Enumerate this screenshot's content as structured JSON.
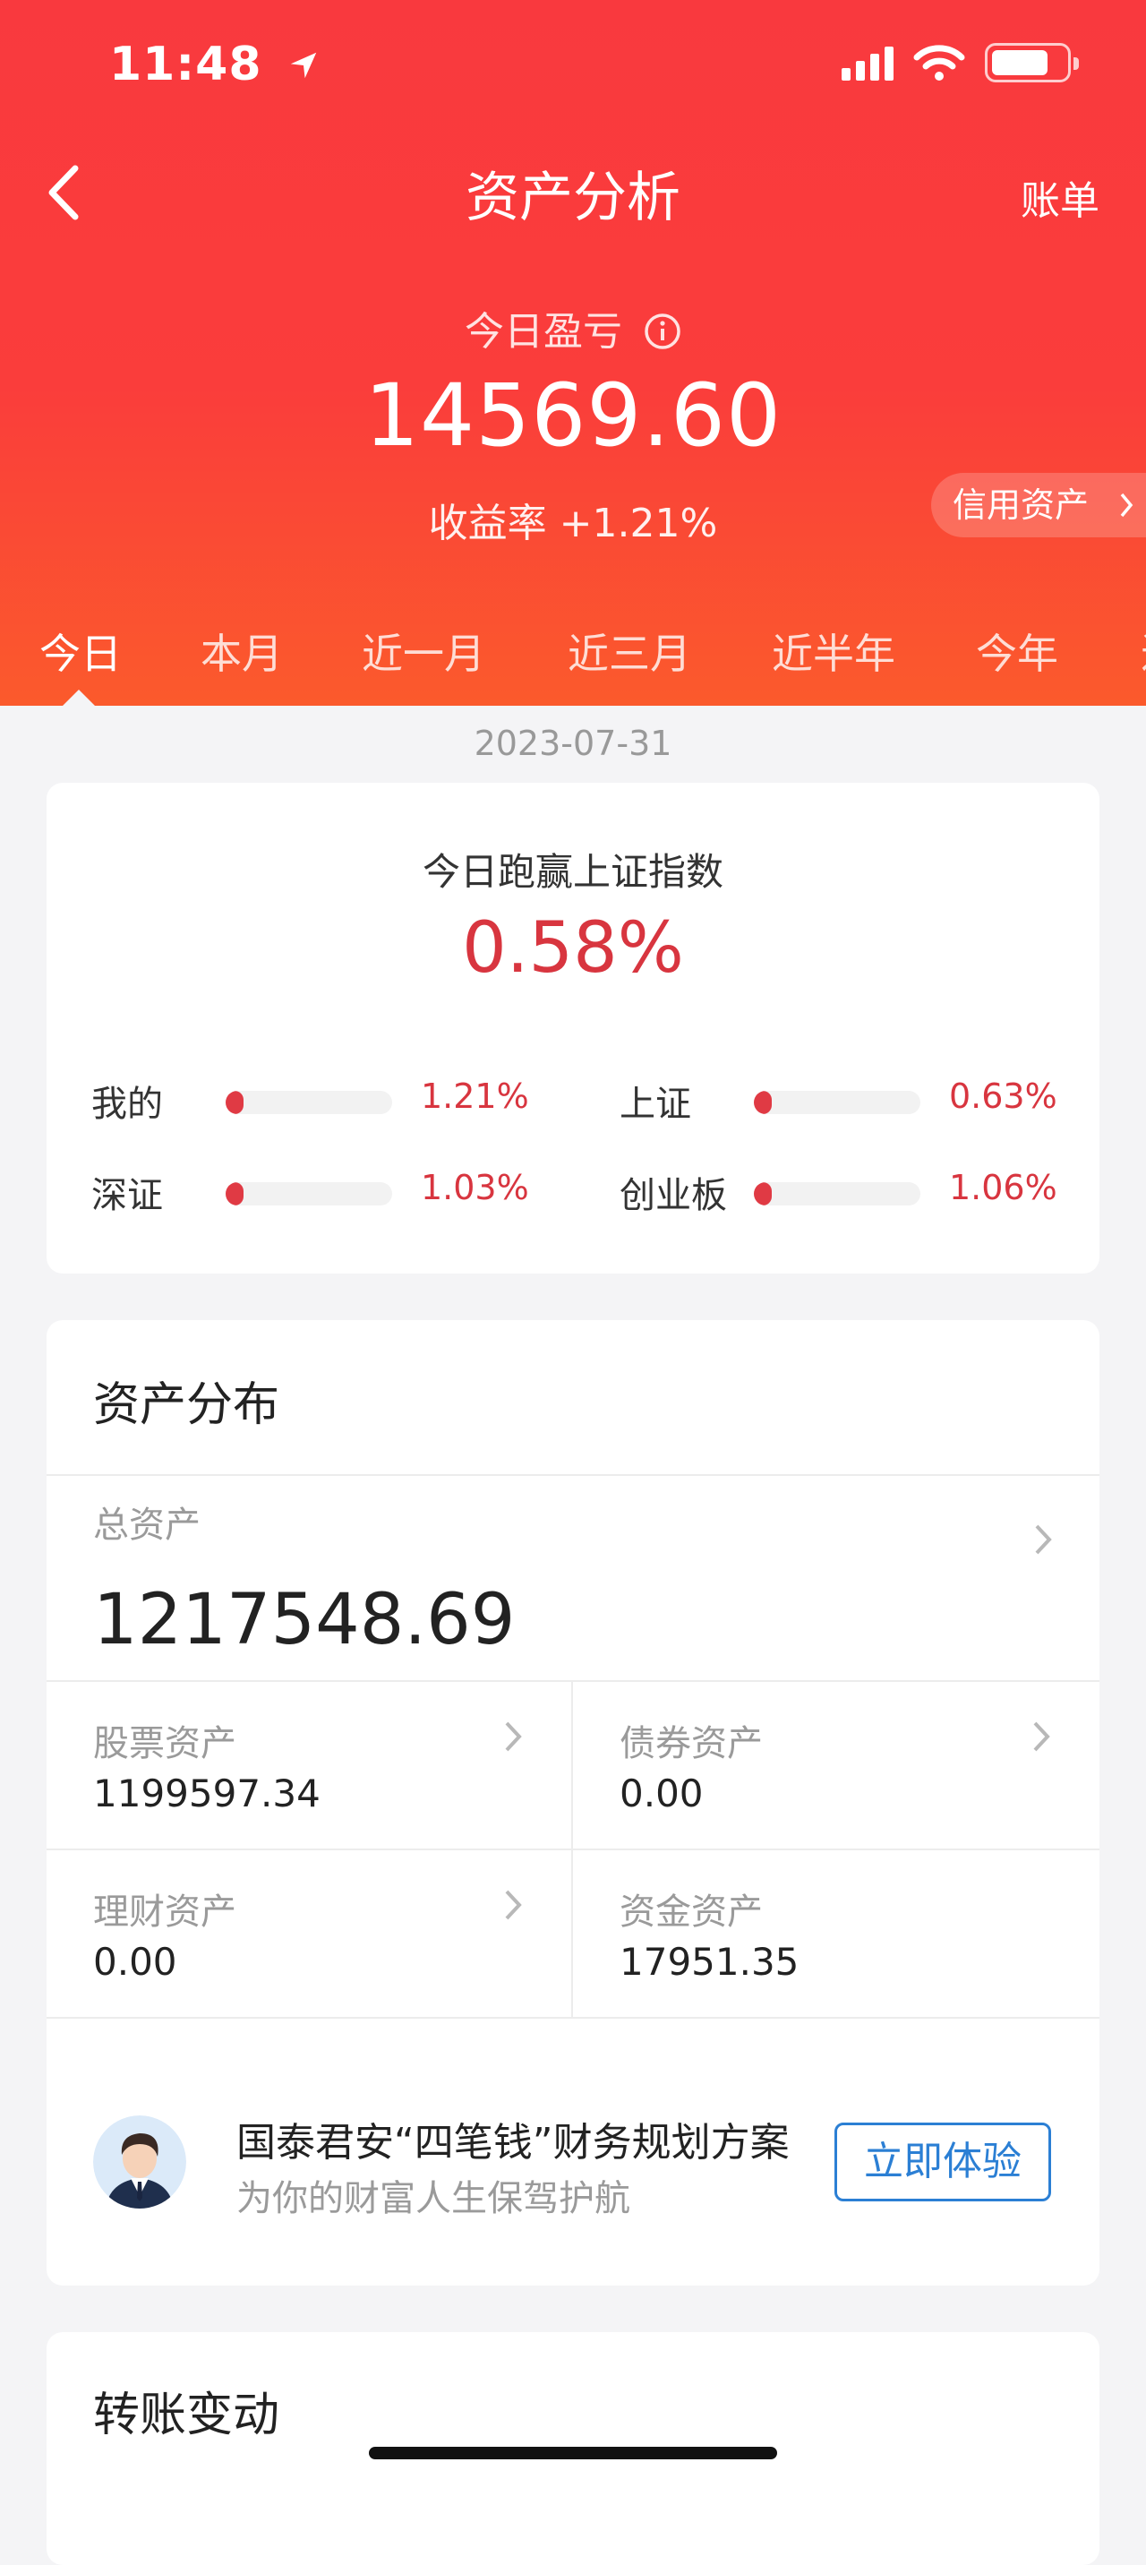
{
  "status_bar": {
    "time": "11:48"
  },
  "nav": {
    "title": "资产分析",
    "right_action": "账单"
  },
  "summary": {
    "pl_label": "今日盈亏",
    "pl_value": "14569.60",
    "yield_text": "收益率 +1.21%",
    "credit_label": "信用资产"
  },
  "tabs": [
    "今日",
    "本月",
    "近一月",
    "近三月",
    "近半年",
    "今年",
    "近"
  ],
  "active_tab": "今日",
  "date": "2023-07-31",
  "beat_index": {
    "title": "今日跑赢上证指数",
    "value": "0.58%",
    "items": [
      {
        "name": "我的",
        "value": "1.21%",
        "progress": 0.0121
      },
      {
        "name": "上证",
        "value": "0.63%",
        "progress": 0.0063
      },
      {
        "name": "深证",
        "value": "1.03%",
        "progress": 0.0103
      },
      {
        "name": "创业板",
        "value": "1.06%",
        "progress": 0.0106
      }
    ]
  },
  "distribution": {
    "title": "资产分布",
    "total_label": "总资产",
    "total_value": "1217548.69",
    "stock_label": "股票资产",
    "stock_value": "1199597.34",
    "bond_label": "债券资产",
    "bond_value": "0.00",
    "wealth_label": "理财资产",
    "wealth_value": "0.00",
    "cash_label": "资金资产",
    "cash_value": "17951.35",
    "promo": {
      "title": "国泰君安“四笔钱”财务规划方案",
      "subtitle": "为你的财富人生保驾护航",
      "button": "立即体验"
    }
  },
  "transfer": {
    "title": "转账变动"
  },
  "colors": {
    "header_red": "#f9393e",
    "accent_red": "#d8353f",
    "link_blue": "#2b7fd4"
  }
}
